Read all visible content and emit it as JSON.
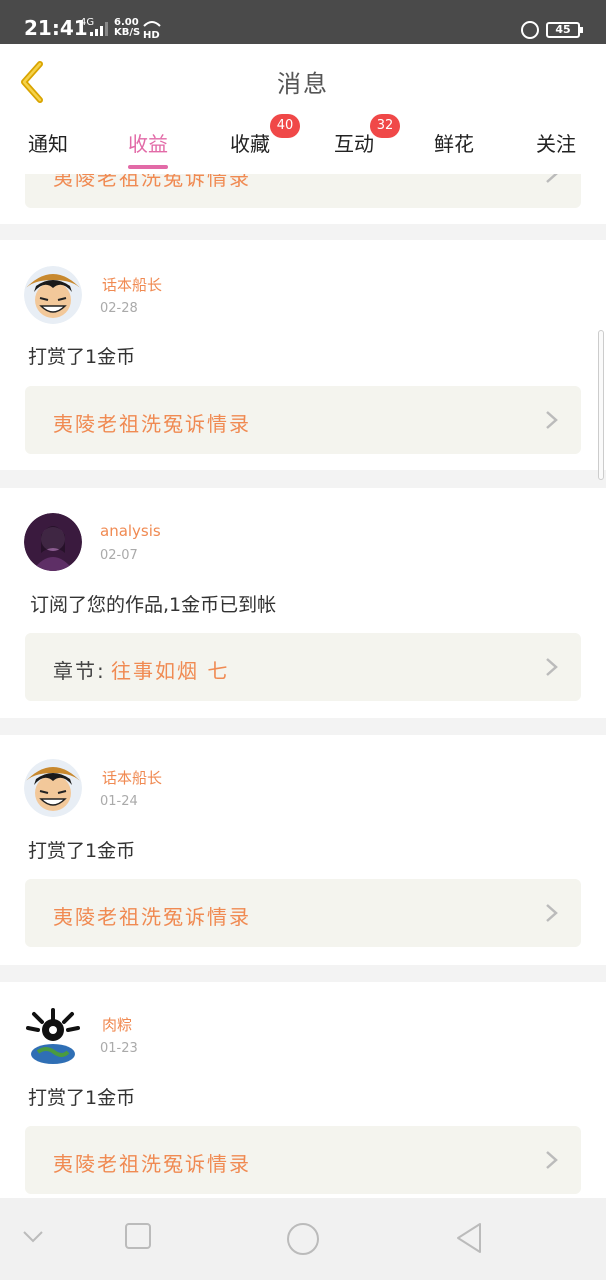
{
  "status_bar": {
    "time": "21:41",
    "network": "4G",
    "speed_value": "6.00",
    "speed_unit": "KB/S",
    "hd": "HD",
    "battery": "45"
  },
  "header": {
    "title": "消息"
  },
  "tabs": [
    {
      "label": "通知",
      "badge": ""
    },
    {
      "label": "收益",
      "badge": "",
      "active": true
    },
    {
      "label": "收藏",
      "badge": "40"
    },
    {
      "label": "互动",
      "badge": "32"
    },
    {
      "label": "鲜花",
      "badge": ""
    },
    {
      "label": "关注",
      "badge": ""
    }
  ],
  "partial_card": {
    "work_title": "夷陵老祖洗冤诉情录"
  },
  "messages": [
    {
      "username": "话本船长",
      "date": "02-28",
      "action": "打赏了1金币",
      "work_title": "夷陵老祖洗冤诉情录"
    },
    {
      "username": "analysis",
      "date": "02-07",
      "action": "订阅了您的作品,1金币已到帐",
      "chapter_prefix": "章节:",
      "chapter_name": "往事如烟 七"
    },
    {
      "username": "话本船长",
      "date": "01-24",
      "action": "打赏了1金币",
      "work_title": "夷陵老祖洗冤诉情录"
    },
    {
      "username": "肉粽",
      "date": "01-23",
      "action": "打赏了1金币",
      "work_title": "夷陵老祖洗冤诉情录"
    }
  ],
  "colors": {
    "accent": "#e26aa7",
    "orange_text": "#f08a52",
    "badge": "#f04848"
  }
}
